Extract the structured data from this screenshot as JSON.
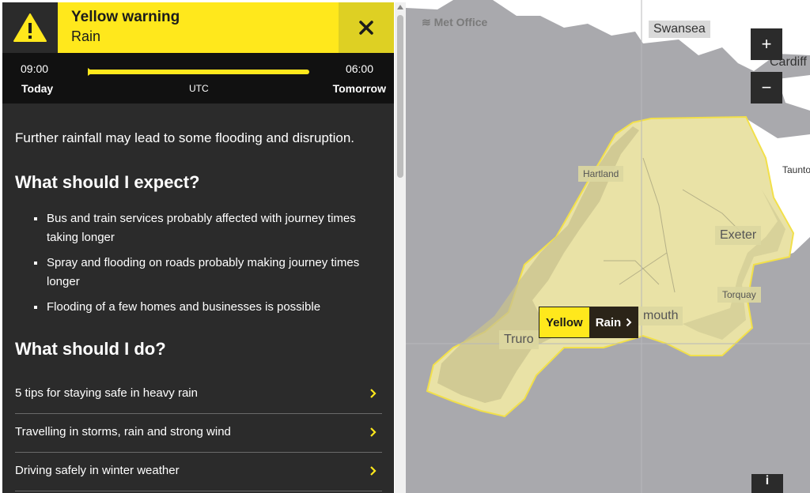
{
  "warning": {
    "level": "Yellow warning",
    "type": "Rain",
    "color": "#ffe81c"
  },
  "timeline": {
    "start_time": "09:00",
    "start_day": "Today",
    "end_time": "06:00",
    "end_day": "Tomorrow",
    "timezone": "UTC"
  },
  "content": {
    "lead": "Further rainfall may lead to some flooding and disruption.",
    "expect_heading": "What should I expect?",
    "expect_items": [
      "Bus and train services probably affected with journey times taking longer",
      "Spray and flooding on roads probably making journey times longer",
      "Flooding of a few homes and businesses is possible"
    ],
    "do_heading": "What should I do?",
    "links": [
      "5 tips for staying safe in heavy rain",
      "Travelling in storms, rain and strong wind",
      "Driving safely in winter weather"
    ]
  },
  "map": {
    "logo": "Met Office",
    "zoom_in": "+",
    "zoom_out": "−",
    "info": "i",
    "places": {
      "swansea": "Swansea",
      "cardiff": "Cardiff",
      "taunton": "Taunto",
      "hartland": "Hartland",
      "exeter": "Exeter",
      "torquay": "Torquay",
      "truro": "Truro",
      "plymouth": "mouth"
    },
    "tag_level": "Yellow",
    "tag_type": "Rain"
  },
  "icons": {
    "warning": "warning-triangle-icon",
    "close": "close-icon",
    "chevron": "chevron-right-icon"
  }
}
